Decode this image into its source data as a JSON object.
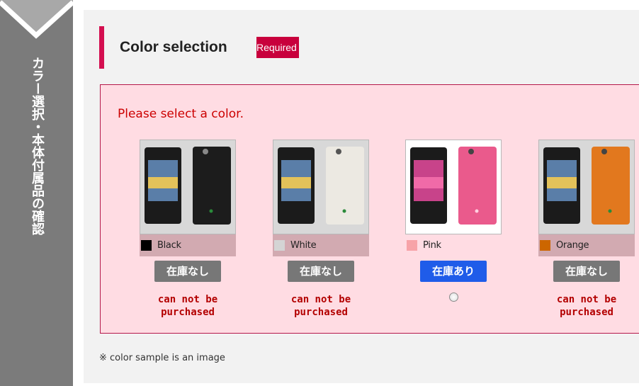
{
  "step": {
    "label": "カラー選択・本体付属品の確認"
  },
  "section": {
    "title": "Color selection",
    "required_badge": "Required"
  },
  "error": {
    "message": "Please select a color."
  },
  "colors": [
    {
      "name": "Black",
      "swatch_color": "#000000",
      "body_color": "#1c1c1c",
      "stock_label": "在庫なし",
      "available": false,
      "note_line1": "can not be",
      "note_line2": "purchased"
    },
    {
      "name": "White",
      "swatch_color": "#d4d4d4",
      "body_color": "#ece9e2",
      "stock_label": "在庫なし",
      "available": false,
      "note_line1": "can not be",
      "note_line2": "purchased"
    },
    {
      "name": "Pink",
      "swatch_color": "#f7a3a8",
      "body_color": "#ea5a8c",
      "stock_label": "在庫あり",
      "available": true
    },
    {
      "name": "Orange",
      "swatch_color": "#cc6600",
      "body_color": "#e2781e",
      "stock_label": "在庫なし",
      "available": false,
      "note_line1": "can not be",
      "note_line2": "purchased"
    }
  ],
  "footnote": "※ color sample is an image",
  "theme": {
    "accent": "#d40f50",
    "error_background": "#ffdce3",
    "in_stock": "#1f5ce9",
    "out_of_stock": "#777777"
  }
}
